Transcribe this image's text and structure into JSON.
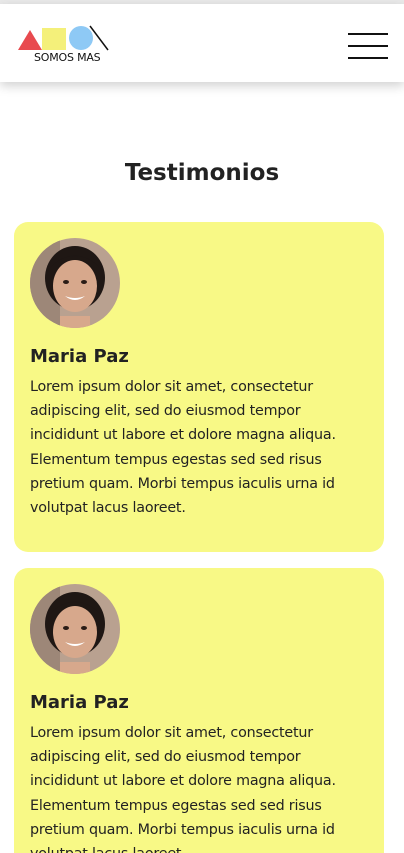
{
  "header": {
    "logo_text": "SOMOS MAS",
    "colors": {
      "triangle": "#e84a4f",
      "square": "#f4f07a",
      "circle": "#8ec9f5"
    }
  },
  "main": {
    "title": "Testimonios",
    "testimonials": [
      {
        "name": "Maria Paz",
        "text": "Lorem ipsum dolor sit amet, consectetur adipiscing elit, sed do eiusmod tempor incididunt ut labore et dolore magna aliqua. Elementum tempus egestas sed sed risus pretium quam. Morbi tempus iaculis urna id volutpat lacus laoreet."
      },
      {
        "name": "Maria Paz",
        "text": "Lorem ipsum dolor sit amet, consectetur adipiscing elit, sed do eiusmod tempor incididunt ut labore et dolore magna aliqua. Elementum tempus egestas sed sed risus pretium quam. Morbi tempus iaculis urna id volutpat lacus laoreet."
      }
    ],
    "card_color": "#f8f986"
  }
}
